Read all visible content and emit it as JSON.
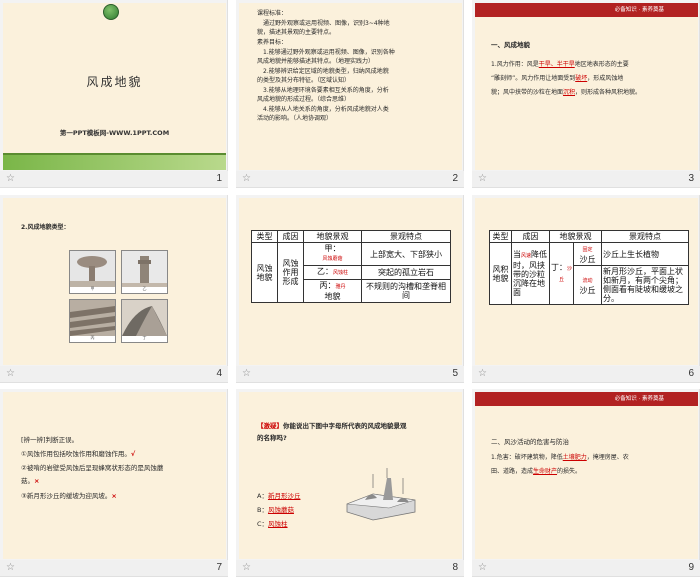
{
  "slides": [
    {
      "num": "1",
      "title": "风成地貌",
      "link": "第一PPT模板网-WWW.1PPT.COM"
    },
    {
      "num": "2",
      "lines": [
        "课程标准：",
        "通过野外观察或运用视频、图像，识别3~4种地",
        "貌，描述其景观的主要特点。",
        "素养目标：",
        "1.能够通过野外观察或运用视频、图像，识别各种",
        "风成地貌并能够描述其特点。（地理实践力）",
        "2.能够辨识给定区域的地貌类型，归纳风成地貌",
        "的类型及其分布特征。（区域认知）",
        "3.能够从地理环境各要素相互关系的角度，分析",
        "风成地貌的形成过程。（综合思维）",
        "4.能够从人地关系的角度，分析风成地貌对人类",
        "活动的影响。（人地协调观）"
      ]
    },
    {
      "num": "3",
      "header": "必备知识 · 素养奠基",
      "heading": "一、风成地貌",
      "p1": "1.风力作用：风是",
      "a1": "干旱、半干旱",
      "p2": "地区地表形态的主要",
      "p3": "“雕刻师”。风力作用让地面受到",
      "a2": "破坏",
      "p4": "，形成风蚀地",
      "p5": "貌；风中挟带的沙粒在地面",
      "a3": "沉积",
      "p6": "，则形成各种风积地貌。"
    },
    {
      "num": "4",
      "heading": "2.风成地貌类型：",
      "labels": [
        "甲",
        "乙",
        "丙",
        "丁"
      ]
    },
    {
      "num": "5",
      "table": {
        "headers": [
          "类型",
          "成因",
          "地貌景观",
          "景观特点"
        ],
        "type": "风蚀地貌",
        "cause": "风蚀作用形成",
        "rows": [
          {
            "prefix": "甲：",
            "answer": "风蚀蘑菇",
            "feature": "上部宽大、下部狭小"
          },
          {
            "prefix": "乙：",
            "answer": "风蚀柱",
            "feature": "突起的孤立岩石"
          },
          {
            "prefix": "丙：",
            "answer": "雅丹",
            "suffix": "地貌",
            "feature": "不规则的沟槽和垄脊相间"
          }
        ]
      }
    },
    {
      "num": "6",
      "table": {
        "headers": [
          "类型",
          "成因",
          "地貌景观",
          "景观特点"
        ],
        "type": "风积地貌",
        "cause_pre": "当",
        "cause_ans": "风速",
        "cause_post": "降低时，风挟带的沙粒沉降在地面",
        "land_pre": "丁：",
        "land_ans": "沙丘",
        "rows": [
          {
            "answer": "固定",
            "name": "沙丘",
            "feature": "沙丘上生长植物"
          },
          {
            "answer": "流动",
            "name": "沙丘",
            "feature": "新月形沙丘，平面上状如新月，有两个尖角；侧面看有陡坡和缓坡之分。"
          }
        ]
      }
    },
    {
      "num": "7",
      "lines": [
        "[辨一辨]判断正误。",
        "①风蚀作用包括吹蚀作用和磨蚀作用。",
        "②被啃的岩壁受风蚀后呈现蜂窝状形态的是风蚀蘑",
        "菇。",
        "③新月形沙丘的缓坡为迎风坡。"
      ],
      "marks": [
        "√",
        "×",
        "×"
      ]
    },
    {
      "num": "8",
      "tag": "【激疑】",
      "q1": "你能说出下图中字母所代表的风成地貌景观",
      "q2": "的名称吗?",
      "answers": [
        {
          "label": "A：",
          "value": "新月形沙丘"
        },
        {
          "label": "B：",
          "value": "风蚀蘑菇"
        },
        {
          "label": "C：",
          "value": "风蚀柱"
        }
      ]
    },
    {
      "num": "9",
      "header": "必备知识 · 素养奠基",
      "heading": "二、风沙活动的危害与防治",
      "p1": "1.危害：破坏建筑物，降低",
      "a1": "土壤肥力",
      "p2": "，掩埋房屋、农",
      "p3": "田、道路，造成",
      "a2": "生命财产",
      "p4": "的损失。"
    }
  ],
  "colors": {
    "slide_bg": "#fbf1dc",
    "accent": "#cc0000",
    "header": "#b22222",
    "green": "#7ab648"
  },
  "icons": {
    "footer": "star-icon"
  }
}
